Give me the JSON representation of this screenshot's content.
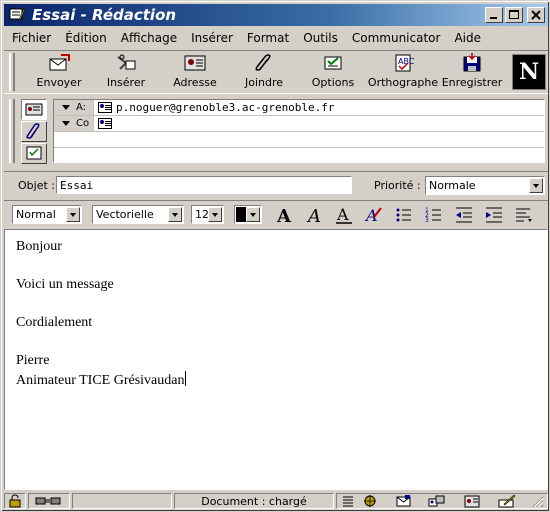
{
  "window": {
    "title": "Essai - Rédaction",
    "minimize": "_",
    "maximize": "□",
    "close": "×"
  },
  "menu": [
    "Fichier",
    "Édition",
    "Affichage",
    "Insérer",
    "Format",
    "Outils",
    "Communicator",
    "Aide"
  ],
  "toolbar": {
    "send": "Envoyer",
    "insert": "Insérer",
    "address": "Adresse",
    "attach": "Joindre",
    "options": "Options",
    "spelling": "Orthographe",
    "save": "Enregistrer",
    "logo": "N"
  },
  "addressing": {
    "rows": [
      {
        "type": "A:",
        "value": "p.noguer@grenoble3.ac-grenoble.fr"
      },
      {
        "type": "Co",
        "value": ""
      }
    ]
  },
  "subject": {
    "label": "Objet :",
    "value": "Essai",
    "priority_label": "Priorité :",
    "priority_value": "Normale"
  },
  "format": {
    "paragraph_style": "Normal",
    "font": "Vectorielle",
    "size": "12",
    "text_color": "#000000"
  },
  "body": {
    "lines": [
      "Bonjour",
      "Voici un message",
      "Cordialement",
      "Pierre",
      "Animateur TICE Grésivaudan"
    ]
  },
  "status": {
    "text": "Document : chargé"
  }
}
